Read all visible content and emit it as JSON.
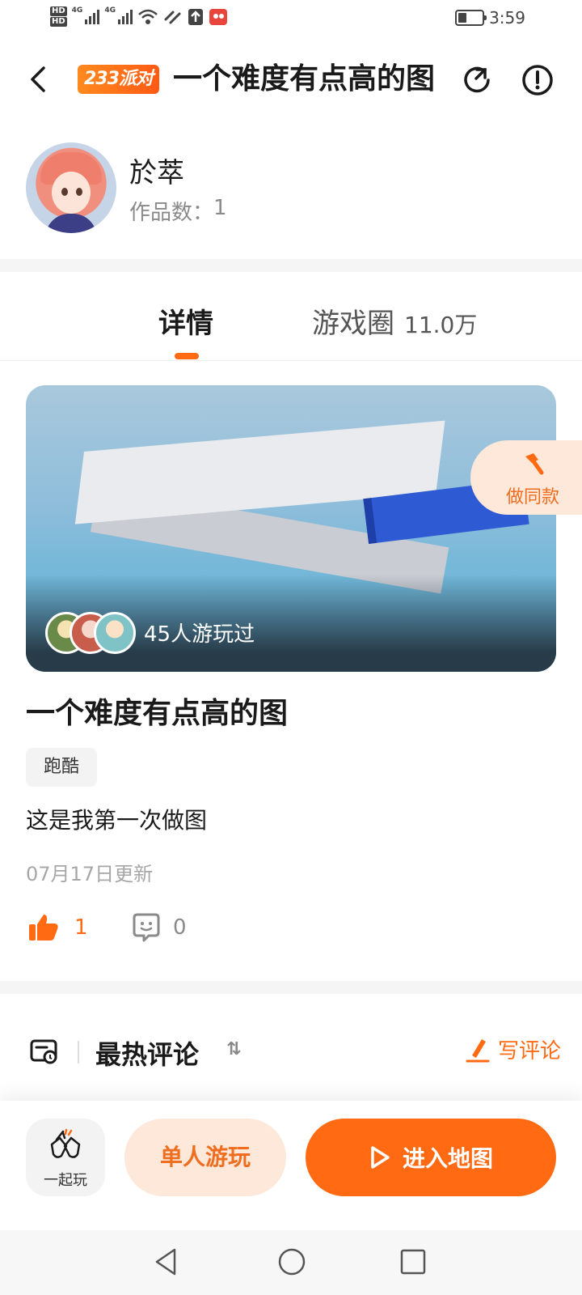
{
  "status_bar": {
    "network_1": "4G",
    "network_2": "4G",
    "time": "3:59",
    "battery_level": 0.3
  },
  "header": {
    "badge": "233派对",
    "title": "一个难度有点高的图"
  },
  "author": {
    "name": "於萃",
    "works_label": "作品数：",
    "works_count": "1"
  },
  "tabs": [
    {
      "label": "详情",
      "active": true
    },
    {
      "label": "游戏圈",
      "count": "11.0万",
      "active": false
    }
  ],
  "cover": {
    "played_count_text": "45人游玩过"
  },
  "make_same": {
    "label": "做同款"
  },
  "game": {
    "title": "一个难度有点高的图",
    "tag": "跑酷",
    "description": "这是我第一次做图",
    "updated": "07月17日更新",
    "likes": "1",
    "comments": "0"
  },
  "comments_section": {
    "title": "最热评论",
    "sort_icon": "⇅",
    "write_label": "写评论"
  },
  "actions": {
    "together": "一起玩",
    "solo": "单人游玩",
    "enter": "进入地图"
  },
  "colors": {
    "accent": "#ff6a13",
    "accent_light": "#fde8da",
    "text_primary": "#1a1a1a",
    "text_secondary": "#8a8a8a"
  }
}
